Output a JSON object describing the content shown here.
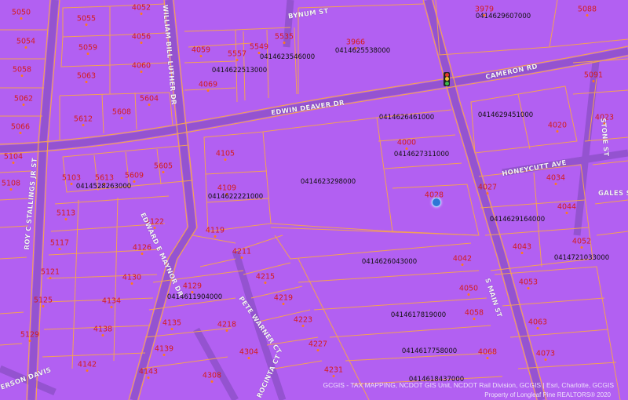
{
  "colors": {
    "background": "#b260f2",
    "parcel_lines": "#f3a154",
    "road_lines": "#7d49b6",
    "address_text": "#d41c1c",
    "parcel_id_text": "#111111",
    "street_label": "#f3f3f3"
  },
  "address_labels": [
    "5050",
    "5055",
    "4052",
    "5054",
    "5059",
    "4056",
    "5058",
    "5063",
    "4060",
    "5062",
    "5612",
    "5608",
    "5604",
    "5066",
    "4059",
    "5557",
    "5549",
    "5535",
    "4069",
    "3966",
    "3979",
    "5088",
    "5091",
    "4023",
    "4020",
    "4000",
    "4028",
    "4027",
    "4034",
    "4044",
    "4043",
    "4052",
    "4053",
    "4042",
    "4050",
    "4058",
    "4063",
    "4073",
    "4068",
    "4105",
    "4109",
    "4119",
    "4211",
    "4215",
    "4219",
    "4223",
    "4227",
    "4231",
    "5104",
    "5103",
    "5613",
    "5609",
    "5605",
    "5108",
    "5113",
    "4122",
    "5117",
    "4126",
    "5121",
    "4130",
    "5125",
    "4134",
    "5129",
    "4138",
    "4142",
    "4143",
    "4129",
    "4135",
    "4218",
    "4139",
    "4304",
    "4308"
  ],
  "parcel_ids": [
    "0414629607000",
    "0414625538000",
    "0414623546000",
    "0414622513000",
    "0414626461000",
    "0414629451000",
    "0414627311000",
    "0414623298000",
    "0414528263000",
    "0414622221000",
    "0414629164000",
    "0414721033000",
    "0414626043000",
    "0414611904000",
    "0414617819000",
    "0414617758000",
    "0414618437000"
  ],
  "streets": [
    "BYNUM ST",
    "CAMERON RD",
    "WILLIAM BILL LUTHER DR",
    "EDWIN DEAVER DR",
    "ROY C STALLINGS JR ST",
    "HONEYCUTT AVE",
    "STONE ST",
    "GALES ST",
    "EDWARD E MAYNOR DR",
    "PETE WARNER CT",
    "S MAIN ST",
    "JEFFERSON DAVIS",
    "ROCINTA CT"
  ],
  "map_icons": [
    "traffic-light-icon",
    "location-marker-icon"
  ],
  "credits": {
    "line1": "GCGIS - TAX MAPPING, NCDOT GIS Unit, NCDOT Rail Division, GCGIS | Esri, Charlotte, GCGIS",
    "line2": "Property of Longleaf Pine REALTORS® 2020"
  }
}
